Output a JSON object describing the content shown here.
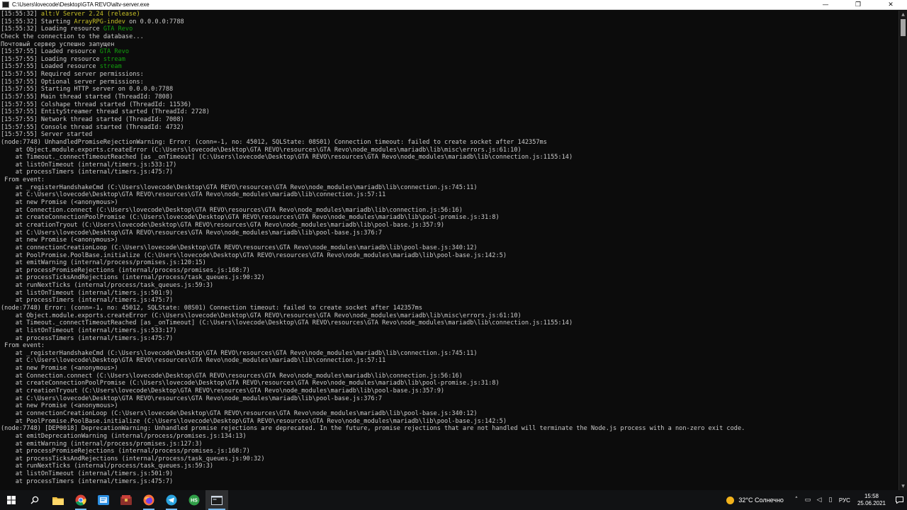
{
  "window": {
    "title": "C:\\Users\\lovecode\\Desktop\\GTA REVO\\altv-server.exe",
    "controls": {
      "minimize": "—",
      "maximize": "❐",
      "close": "✕"
    }
  },
  "console": {
    "colors": {
      "default": "#cccccc",
      "yellow": "#c7c026",
      "green": "#13a10e",
      "background": "#0c0c0c"
    },
    "lines": [
      [
        {
          "t": "[15:55:32] "
        },
        {
          "t": "alt:V",
          "c": "y"
        },
        {
          "t": " Server 2.24 (release)",
          "c": "y"
        }
      ],
      [
        {
          "t": "[15:55:32] Starting "
        },
        {
          "t": "ArrayRPG-indev",
          "c": "y"
        },
        {
          "t": " on 0.0.0.0:7788"
        }
      ],
      [
        {
          "t": "[15:55:32] Loading resource "
        },
        {
          "t": "GTA Revo",
          "c": "g"
        }
      ],
      [
        {
          "t": "Check the connection to the database..."
        }
      ],
      [
        {
          "t": "Почтовый сервер успешно запущен"
        }
      ],
      [
        {
          "t": "[15:57:55] Loaded resource "
        },
        {
          "t": "GTA Revo",
          "c": "g"
        }
      ],
      [
        {
          "t": "[15:57:55] Loading resource "
        },
        {
          "t": "stream",
          "c": "g"
        }
      ],
      [
        {
          "t": "[15:57:55] Loaded resource "
        },
        {
          "t": "stream",
          "c": "g"
        }
      ],
      [
        {
          "t": "[15:57:55] Required server permissions:"
        }
      ],
      [
        {
          "t": "[15:57:55] Optional server permissions:"
        }
      ],
      [
        {
          "t": "[15:57:55] Starting HTTP server on 0.0.0.0:7788"
        }
      ],
      [
        {
          "t": "[15:57:55] Main thread started (ThreadId: 7808)"
        }
      ],
      [
        {
          "t": "[15:57:55] Colshape thread started (ThreadId: 11536)"
        }
      ],
      [
        {
          "t": "[15:57:55] EntityStreamer thread started (ThreadId: 2728)"
        }
      ],
      [
        {
          "t": "[15:57:55] Network thread started (ThreadId: 7008)"
        }
      ],
      [
        {
          "t": "[15:57:55] Console thread started (ThreadId: 4732)"
        }
      ],
      [
        {
          "t": "[15:57:55] Server started"
        }
      ],
      [
        {
          "t": "(node:7748) UnhandledPromiseRejectionWarning: Error: (conn=-1, no: 45012, SQLState: 08S01) Connection timeout: failed to create socket after 142357ms"
        }
      ],
      [
        {
          "t": "    at Object.module.exports.createError (C:\\Users\\lovecode\\Desktop\\GTA REVO\\resources\\GTA Revo\\node_modules\\mariadb\\lib\\misc\\errors.js:61:10)"
        }
      ],
      [
        {
          "t": "    at Timeout._connectTimeoutReached [as _onTimeout] (C:\\Users\\lovecode\\Desktop\\GTA REVO\\resources\\GTA Revo\\node_modules\\mariadb\\lib\\connection.js:1155:14)"
        }
      ],
      [
        {
          "t": "    at listOnTimeout (internal/timers.js:533:17)"
        }
      ],
      [
        {
          "t": "    at processTimers (internal/timers.js:475:7)"
        }
      ],
      [
        {
          "t": " From event:"
        }
      ],
      [
        {
          "t": "    at _registerHandshakeCmd (C:\\Users\\lovecode\\Desktop\\GTA REVO\\resources\\GTA Revo\\node_modules\\mariadb\\lib\\connection.js:745:11)"
        }
      ],
      [
        {
          "t": "    at C:\\Users\\lovecode\\Desktop\\GTA REVO\\resources\\GTA Revo\\node_modules\\mariadb\\lib\\connection.js:57:11"
        }
      ],
      [
        {
          "t": "    at new Promise (<anonymous>)"
        }
      ],
      [
        {
          "t": "    at Connection.connect (C:\\Users\\lovecode\\Desktop\\GTA REVO\\resources\\GTA Revo\\node_modules\\mariadb\\lib\\connection.js:56:16)"
        }
      ],
      [
        {
          "t": "    at createConnectionPoolPromise (C:\\Users\\lovecode\\Desktop\\GTA REVO\\resources\\GTA Revo\\node_modules\\mariadb\\lib\\pool-promise.js:31:8)"
        }
      ],
      [
        {
          "t": "    at creationTryout (C:\\Users\\lovecode\\Desktop\\GTA REVO\\resources\\GTA Revo\\node_modules\\mariadb\\lib\\pool-base.js:357:9)"
        }
      ],
      [
        {
          "t": "    at C:\\Users\\lovecode\\Desktop\\GTA REVO\\resources\\GTA Revo\\node_modules\\mariadb\\lib\\pool-base.js:376:7"
        }
      ],
      [
        {
          "t": "    at new Promise (<anonymous>)"
        }
      ],
      [
        {
          "t": "    at connectionCreationLoop (C:\\Users\\lovecode\\Desktop\\GTA REVO\\resources\\GTA Revo\\node_modules\\mariadb\\lib\\pool-base.js:340:12)"
        }
      ],
      [
        {
          "t": "    at PoolPromise.PoolBase.initialize (C:\\Users\\lovecode\\Desktop\\GTA REVO\\resources\\GTA Revo\\node_modules\\mariadb\\lib\\pool-base.js:142:5)"
        }
      ],
      [
        {
          "t": "    at emitWarning (internal/process/promises.js:120:15)"
        }
      ],
      [
        {
          "t": "    at processPromiseRejections (internal/process/promises.js:168:7)"
        }
      ],
      [
        {
          "t": "    at processTicksAndRejections (internal/process/task_queues.js:90:32)"
        }
      ],
      [
        {
          "t": "    at runNextTicks (internal/process/task_queues.js:59:3)"
        }
      ],
      [
        {
          "t": "    at listOnTimeout (internal/timers.js:501:9)"
        }
      ],
      [
        {
          "t": "    at processTimers (internal/timers.js:475:7)"
        }
      ],
      [
        {
          "t": "(node:7748) Error: (conn=-1, no: 45012, SQLState: 08S01) Connection timeout: failed to create socket after 142357ms"
        }
      ],
      [
        {
          "t": "    at Object.module.exports.createError (C:\\Users\\lovecode\\Desktop\\GTA REVO\\resources\\GTA Revo\\node_modules\\mariadb\\lib\\misc\\errors.js:61:10)"
        }
      ],
      [
        {
          "t": "    at Timeout._connectTimeoutReached [as _onTimeout] (C:\\Users\\lovecode\\Desktop\\GTA REVO\\resources\\GTA Revo\\node_modules\\mariadb\\lib\\connection.js:1155:14)"
        }
      ],
      [
        {
          "t": "    at listOnTimeout (internal/timers.js:533:17)"
        }
      ],
      [
        {
          "t": "    at processTimers (internal/timers.js:475:7)"
        }
      ],
      [
        {
          "t": " From event:"
        }
      ],
      [
        {
          "t": "    at _registerHandshakeCmd (C:\\Users\\lovecode\\Desktop\\GTA REVO\\resources\\GTA Revo\\node_modules\\mariadb\\lib\\connection.js:745:11)"
        }
      ],
      [
        {
          "t": "    at C:\\Users\\lovecode\\Desktop\\GTA REVO\\resources\\GTA Revo\\node_modules\\mariadb\\lib\\connection.js:57:11"
        }
      ],
      [
        {
          "t": "    at new Promise (<anonymous>)"
        }
      ],
      [
        {
          "t": "    at Connection.connect (C:\\Users\\lovecode\\Desktop\\GTA REVO\\resources\\GTA Revo\\node_modules\\mariadb\\lib\\connection.js:56:16)"
        }
      ],
      [
        {
          "t": "    at createConnectionPoolPromise (C:\\Users\\lovecode\\Desktop\\GTA REVO\\resources\\GTA Revo\\node_modules\\mariadb\\lib\\pool-promise.js:31:8)"
        }
      ],
      [
        {
          "t": "    at creationTryout (C:\\Users\\lovecode\\Desktop\\GTA REVO\\resources\\GTA Revo\\node_modules\\mariadb\\lib\\pool-base.js:357:9)"
        }
      ],
      [
        {
          "t": "    at C:\\Users\\lovecode\\Desktop\\GTA REVO\\resources\\GTA Revo\\node_modules\\mariadb\\lib\\pool-base.js:376:7"
        }
      ],
      [
        {
          "t": "    at new Promise (<anonymous>)"
        }
      ],
      [
        {
          "t": "    at connectionCreationLoop (C:\\Users\\lovecode\\Desktop\\GTA REVO\\resources\\GTA Revo\\node_modules\\mariadb\\lib\\pool-base.js:340:12)"
        }
      ],
      [
        {
          "t": "    at PoolPromise.PoolBase.initialize (C:\\Users\\lovecode\\Desktop\\GTA REVO\\resources\\GTA Revo\\node_modules\\mariadb\\lib\\pool-base.js:142:5)"
        }
      ],
      [
        {
          "t": "(node:7748) [DEP0018] DeprecationWarning: Unhandled promise rejections are deprecated. In the future, promise rejections that are not handled will terminate the Node.js process with a non-zero exit code."
        }
      ],
      [
        {
          "t": "    at emitDeprecationWarning (internal/process/promises.js:134:13)"
        }
      ],
      [
        {
          "t": "    at emitWarning (internal/process/promises.js:127:3)"
        }
      ],
      [
        {
          "t": "    at processPromiseRejections (internal/process/promises.js:168:7)"
        }
      ],
      [
        {
          "t": "    at processTicksAndRejections (internal/process/task_queues.js:90:32)"
        }
      ],
      [
        {
          "t": "    at runNextTicks (internal/process/task_queues.js:59:3)"
        }
      ],
      [
        {
          "t": "    at listOnTimeout (internal/timers.js:501:9)"
        }
      ],
      [
        {
          "t": "    at processTimers (internal/timers.js:475:7)"
        }
      ]
    ]
  },
  "taskbar": {
    "apps": [
      {
        "name": "start-button",
        "icon": "windows-logo-icon",
        "color": "#ffffff"
      },
      {
        "name": "search-button",
        "icon": "search-icon",
        "color": "#ffffff"
      },
      {
        "name": "taskbar-app-file-explorer",
        "icon": "folder-icon",
        "color": "#f3c243"
      },
      {
        "name": "taskbar-app-chrome",
        "icon": "chrome-icon",
        "color": "#4285f4"
      },
      {
        "name": "taskbar-app-vscode",
        "icon": "vscode-icon",
        "color": "#2b8fe3"
      },
      {
        "name": "taskbar-app-archive",
        "icon": "archive-icon",
        "color": "#c9403a"
      },
      {
        "name": "taskbar-app-firefox",
        "icon": "firefox-icon",
        "color": "#ff7139"
      },
      {
        "name": "taskbar-app-telegram",
        "icon": "telegram-icon",
        "color": "#2aa3df"
      },
      {
        "name": "taskbar-app-heidisql",
        "icon": "hs-icon",
        "color": "#2f9f47"
      },
      {
        "name": "taskbar-app-console",
        "icon": "console-icon",
        "color": "#cfd8e3"
      }
    ],
    "tray": {
      "weather": "32°C  Солнечно",
      "language": "РУС",
      "time": "15:58",
      "date": "25.06.2021"
    }
  }
}
